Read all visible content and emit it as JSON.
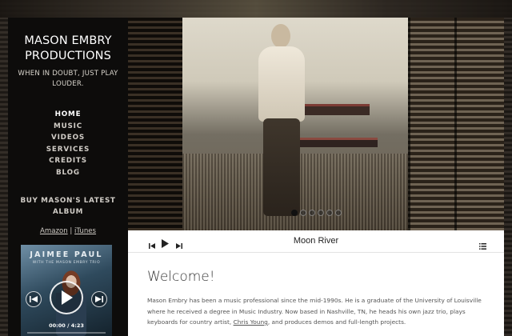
{
  "site": {
    "title": "MASON EMBRY PRODUCTIONS",
    "tagline": "WHEN IN DOUBT, JUST PLAY LOUDER."
  },
  "nav": {
    "items": [
      {
        "label": "HOME",
        "active": true
      },
      {
        "label": "MUSIC",
        "active": false
      },
      {
        "label": "VIDEOS",
        "active": false
      },
      {
        "label": "SERVICES",
        "active": false
      },
      {
        "label": "CREDITS",
        "active": false
      },
      {
        "label": "BLOG",
        "active": false
      }
    ]
  },
  "buy": {
    "heading": "BUY MASON'S LATEST ALBUM",
    "amazon": "Amazon",
    "separator": "|",
    "itunes": "iTunes"
  },
  "album": {
    "artist": "JAIMEE PAUL",
    "subtitle": "WITH THE MASON EMBRY TRIO",
    "time": "00:00 / 4:23",
    "progress": 0
  },
  "slider": {
    "slide_count": 6,
    "active_index": 0
  },
  "player": {
    "track_title": "Moon River",
    "icons": [
      "skip-back-icon",
      "play-icon",
      "skip-forward-icon",
      "playlist-icon"
    ]
  },
  "content": {
    "heading": "Welcome!",
    "text_before_link": "Mason Embry has been a music professional since the mid-1990s. He is a graduate of the University of Louisville where he received a degree in Music Industry. Now based in Nashville, TN, he heads his own jazz trio, plays keyboards for country artist, ",
    "link": "Chris Young",
    "text_after_link": ", and produces demos and full-length projects."
  },
  "colors": {
    "sidebar": "#0d0c0b",
    "content_bg": "#ffffff",
    "text": "#555555"
  }
}
